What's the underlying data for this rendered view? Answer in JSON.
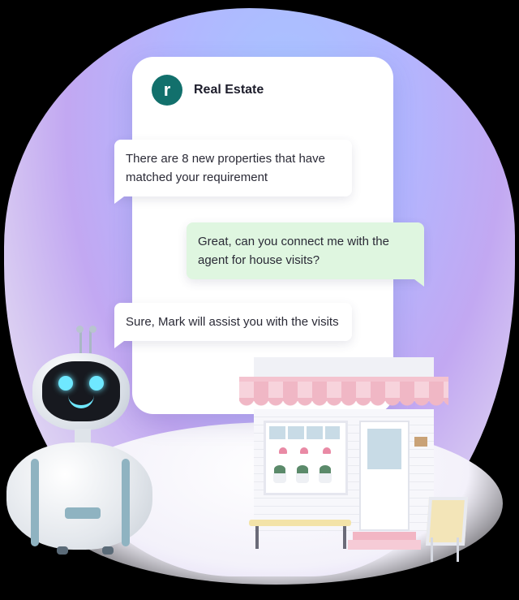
{
  "chat": {
    "avatar_glyph": "r",
    "title": "Real Estate",
    "messages": [
      {
        "from": "bot",
        "text": "There are 8 new properties that have matched your requirement"
      },
      {
        "from": "user",
        "text": "Great, can you connect me with the agent for house visits?"
      },
      {
        "from": "bot",
        "text": "Sure, Mark will assist you with the visits"
      }
    ]
  },
  "colors": {
    "avatar_bg": "#12706c",
    "user_bubble": "#dff6e0",
    "bot_bubble": "#ffffff",
    "robot_eyes": "#6fe8ff",
    "awning_pink": "#f0b7c5"
  },
  "decor": {
    "robot": "robot-mascot",
    "store": "storefront-illustration"
  }
}
